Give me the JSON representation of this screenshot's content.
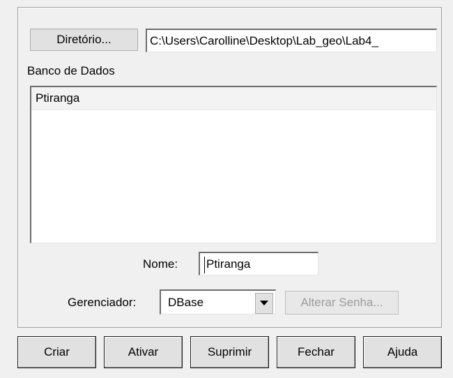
{
  "directory": {
    "button_label": "Diretório...",
    "path_value": "C:\\Users\\Carolline\\Desktop\\Lab_geo\\Lab4_"
  },
  "database": {
    "section_label": "Banco de Dados",
    "items": [
      "Ptiranga"
    ]
  },
  "name": {
    "label": "Nome:",
    "value": "Ptiranga"
  },
  "manager": {
    "label": "Gerenciador:",
    "selected": "DBase",
    "change_password_label": "Alterar Senha..."
  },
  "actions": {
    "create": "Criar",
    "activate": "Ativar",
    "delete": "Suprimir",
    "close": "Fechar",
    "help": "Ajuda"
  },
  "icons": {
    "dropdown": "chevron-down-icon"
  }
}
